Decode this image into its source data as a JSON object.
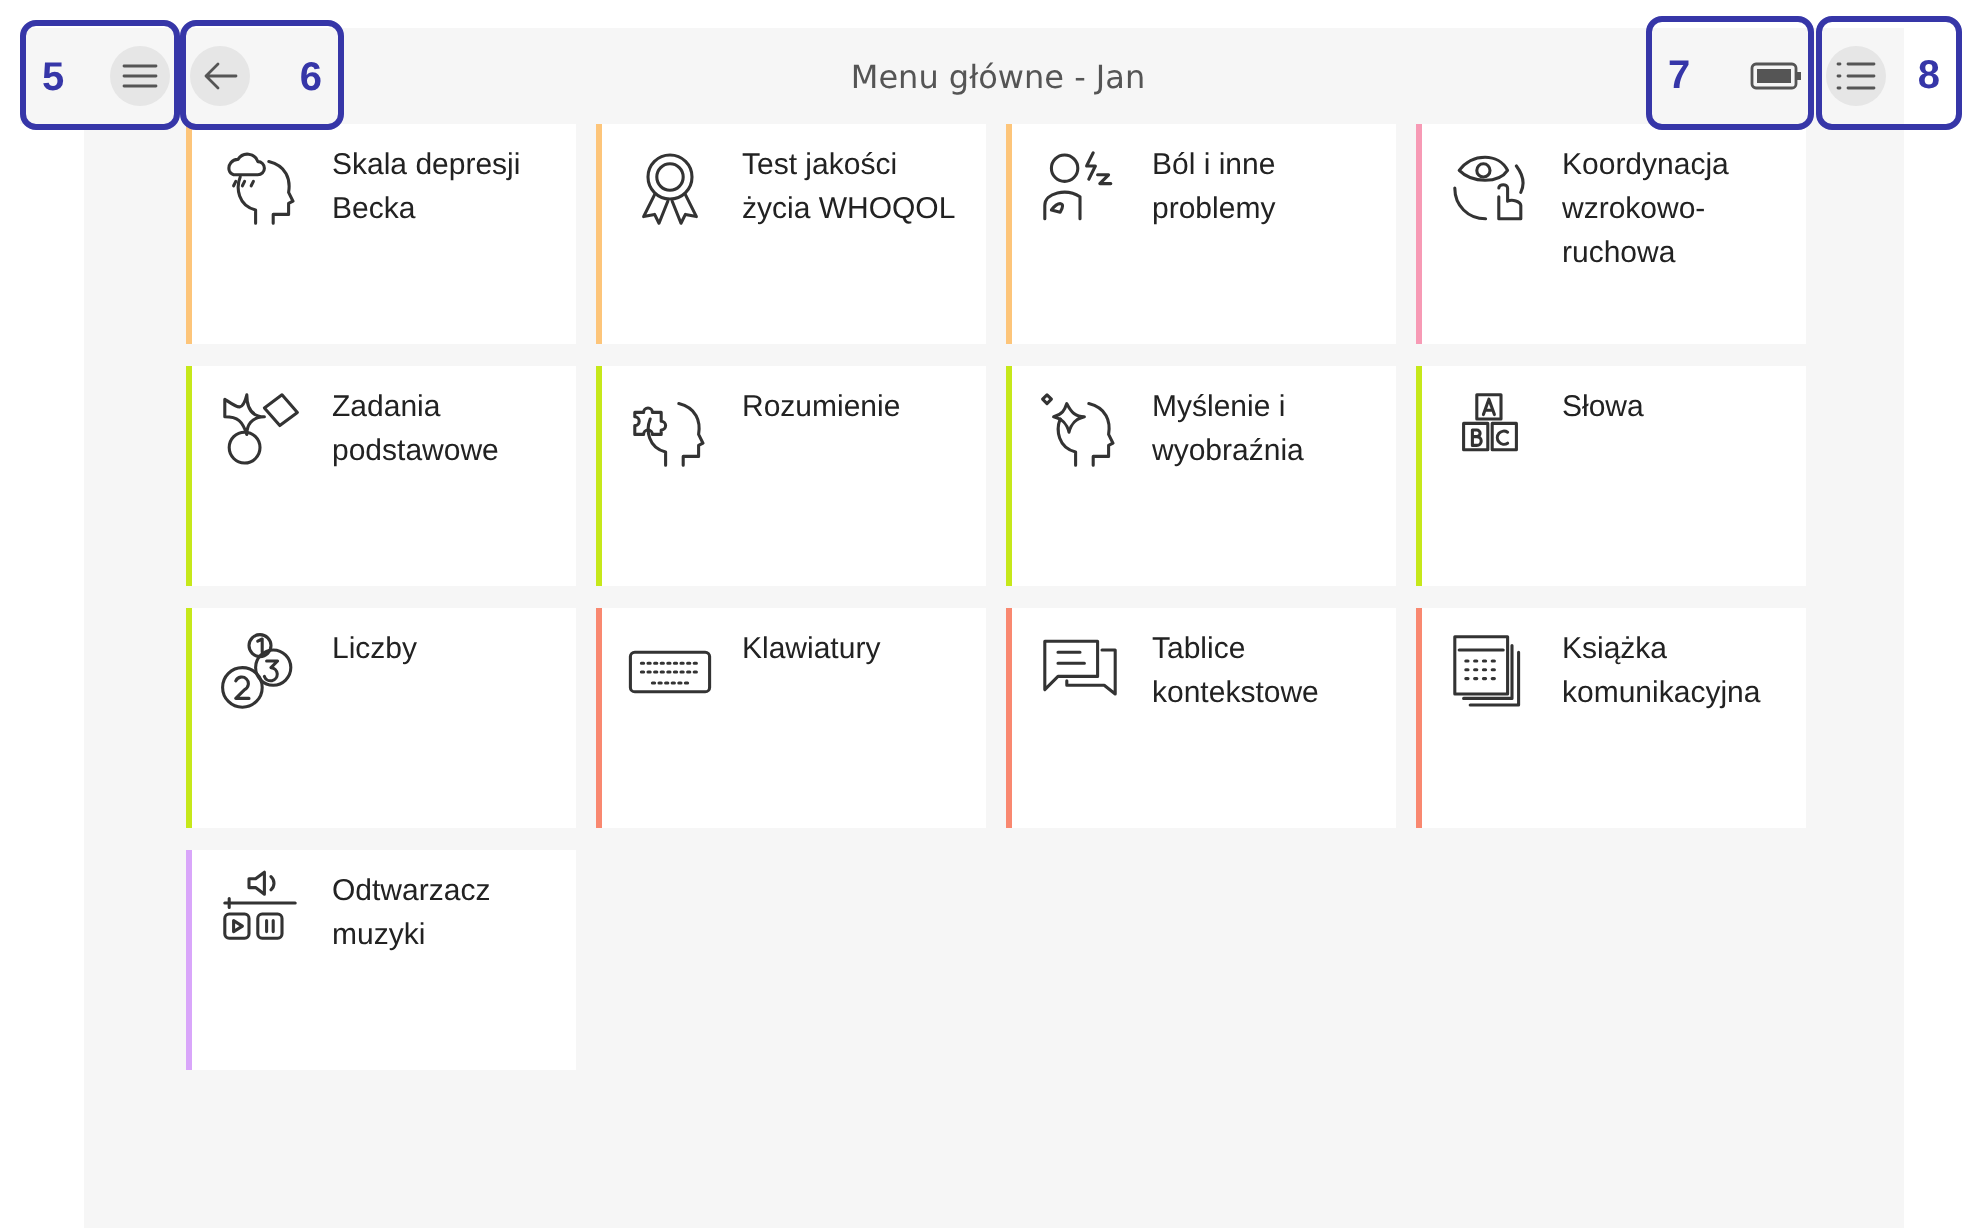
{
  "header": {
    "title": "Menu główne - Jan"
  },
  "tiles": [
    {
      "label": "Skala depresji Becka",
      "color": "#fdc57a"
    },
    {
      "label": "Test jakości życia WHOQOL",
      "color": "#fdc57a"
    },
    {
      "label": "Ból i inne problemy",
      "color": "#fdc57a"
    },
    {
      "label": "Koordynacja wzrokowo-ruchowa",
      "color": "#f79ab5"
    },
    {
      "label": "Zadania podstawowe",
      "color": "#c6e81a"
    },
    {
      "label": "Rozumienie",
      "color": "#c6e81a"
    },
    {
      "label": "Myślenie i wyobraźnia",
      "color": "#c6e81a"
    },
    {
      "label": "Słowa",
      "color": "#c6e81a"
    },
    {
      "label": "Liczby",
      "color": "#c6e81a"
    },
    {
      "label": "Klawiatury",
      "color": "#f98870"
    },
    {
      "label": "Tablice kontekstowe",
      "color": "#f98870"
    },
    {
      "label": "Książka komunikacyjna",
      "color": "#f98870"
    },
    {
      "label": "Odtwarzacz muzyki",
      "color": "#d9a6fa"
    }
  ],
  "callouts": [
    {
      "number": "5"
    },
    {
      "number": "6"
    },
    {
      "number": "7"
    },
    {
      "number": "8"
    }
  ]
}
